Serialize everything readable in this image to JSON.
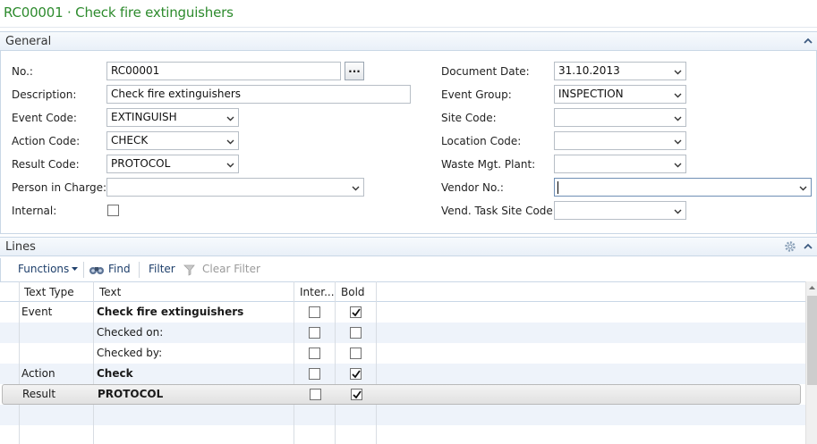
{
  "page": {
    "title": "RC00001 · Check fire extinguishers"
  },
  "general": {
    "header": "General",
    "left": {
      "no_label": "No.:",
      "no_value": "RC00001",
      "assist_label": "...",
      "description_label": "Description:",
      "description_value": "Check fire extinguishers",
      "event_code_label": "Event Code:",
      "event_code_value": "EXTINGUISH",
      "action_code_label": "Action Code:",
      "action_code_value": "CHECK",
      "result_code_label": "Result Code:",
      "result_code_value": "PROTOCOL",
      "person_label": "Person in Charge:",
      "person_value": "",
      "internal_label": "Internal:",
      "internal_checked": false
    },
    "right": {
      "document_date_label": "Document Date:",
      "document_date_value": "31.10.2013",
      "event_group_label": "Event Group:",
      "event_group_value": "INSPECTION",
      "site_code_label": "Site Code:",
      "site_code_value": "",
      "location_code_label": "Location Code:",
      "location_code_value": "",
      "waste_label": "Waste Mgt. Plant:",
      "waste_value": "",
      "vendor_label": "Vendor No.:",
      "vendor_value": "",
      "vend_task_label": "Vend. Task Site Code:",
      "vend_task_value": ""
    }
  },
  "lines": {
    "header": "Lines",
    "toolbar": {
      "functions": "Functions",
      "find": "Find",
      "filter": "Filter",
      "clear_filter": "Clear Filter"
    },
    "columns": {
      "text_type": "Text Type",
      "text": "Text",
      "internal": "Inter...",
      "bold": "Bold"
    },
    "rows": [
      {
        "text_type": "Event",
        "text": "Check fire extinguishers",
        "bold_text": true,
        "internal": false,
        "bold": true
      },
      {
        "text_type": "",
        "text": "Checked on:",
        "bold_text": false,
        "internal": false,
        "bold": false
      },
      {
        "text_type": "",
        "text": "Checked by:",
        "bold_text": false,
        "internal": false,
        "bold": false
      },
      {
        "text_type": "Action",
        "text": "Check",
        "bold_text": true,
        "internal": false,
        "bold": true
      },
      {
        "text_type": "Result",
        "text": "PROTOCOL",
        "bold_text": true,
        "internal": false,
        "bold": true
      }
    ]
  },
  "colors": {
    "title": "#2e8b2e",
    "header_bg": "#e9f0f8",
    "alt_row": "#eef3fa"
  }
}
